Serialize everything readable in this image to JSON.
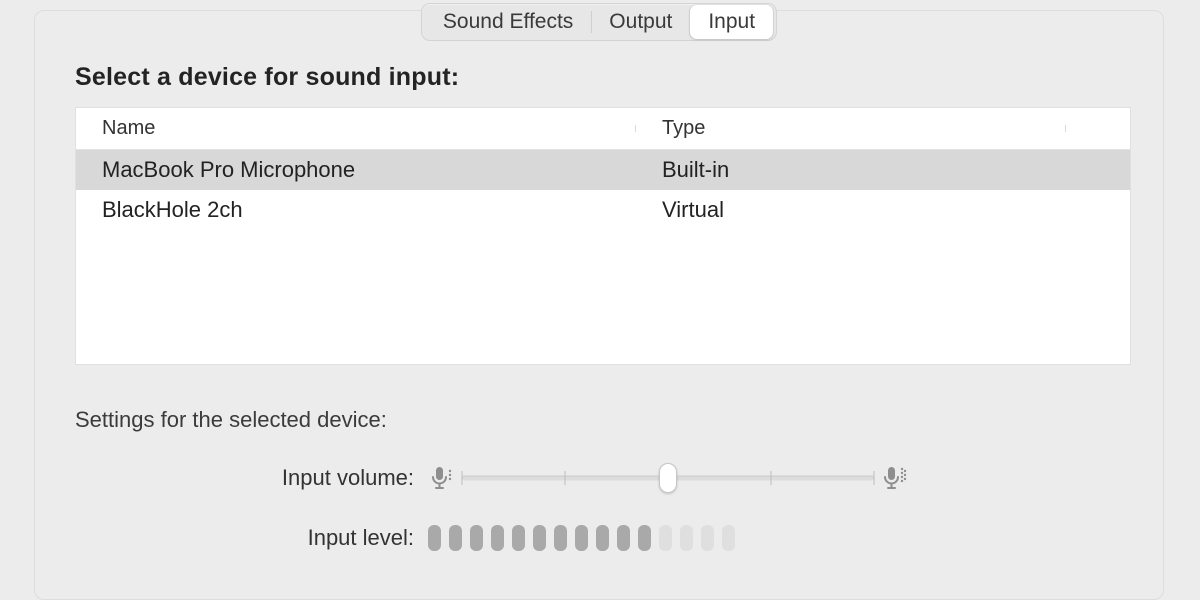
{
  "tabs": {
    "items": [
      "Sound Effects",
      "Output",
      "Input"
    ],
    "active_index": 2
  },
  "heading": "Select a device for sound input:",
  "table": {
    "columns": [
      "Name",
      "Type"
    ],
    "rows": [
      {
        "name": "MacBook Pro Microphone",
        "type": "Built-in",
        "selected": true
      },
      {
        "name": "BlackHole 2ch",
        "type": "Virtual",
        "selected": false
      }
    ]
  },
  "settings_heading": "Settings for the selected device:",
  "volume": {
    "label": "Input volume:",
    "value": 0.5,
    "ticks": [
      0.0,
      0.25,
      0.5,
      0.75,
      1.0
    ]
  },
  "level": {
    "label": "Input level:",
    "segments": 15,
    "active": 11
  }
}
